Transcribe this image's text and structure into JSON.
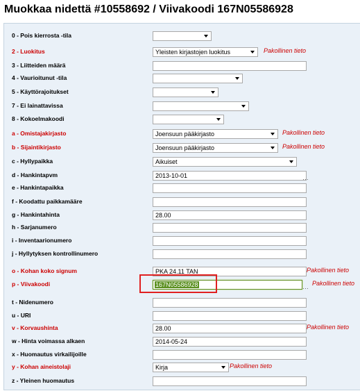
{
  "page": {
    "title": "Muokkaa nidettä #10558692 / Viivakoodi 167N05586928"
  },
  "required_text": "Pakollinen tieto",
  "fields": [
    {
      "label": "0 - Pois kierrosta -tila",
      "required": false,
      "type": "select",
      "value": ""
    },
    {
      "label": "2 - Luokitus",
      "required": true,
      "type": "select",
      "value": "Yleisten kirjastojen luokitus"
    },
    {
      "label": "3 - Liitteiden määrä",
      "required": false,
      "type": "text",
      "value": ""
    },
    {
      "label": "4 - Vaurioitunut -tila",
      "required": false,
      "type": "select",
      "value": ""
    },
    {
      "label": "5 - Käyttörajoitukset",
      "required": false,
      "type": "select",
      "value": ""
    },
    {
      "label": "7 - Ei lainattavissa",
      "required": false,
      "type": "select",
      "value": ""
    },
    {
      "label": "8 - Kokoelmakoodi",
      "required": false,
      "type": "select",
      "value": ""
    },
    {
      "label": "a - Omistajakirjasto",
      "required": true,
      "type": "select",
      "value": "Joensuun pääkirjasto"
    },
    {
      "label": "b - Sijaintikirjasto",
      "required": true,
      "type": "select",
      "value": "Joensuun pääkirjasto"
    },
    {
      "label": "c - Hyllypaikka",
      "required": false,
      "type": "select",
      "value": "Aikuiset"
    },
    {
      "label": "d - Hankintapvm",
      "required": false,
      "type": "text",
      "value": "2013-10-01"
    },
    {
      "label": "e - Hankintapaikka",
      "required": false,
      "type": "text",
      "value": ""
    },
    {
      "label": "f - Koodattu paikkamääre",
      "required": false,
      "type": "text",
      "value": ""
    },
    {
      "label": "g - Hankintahinta",
      "required": false,
      "type": "text",
      "value": "28.00"
    },
    {
      "label": "h - Sarjanumero",
      "required": false,
      "type": "text",
      "value": ""
    },
    {
      "label": "i - Inventaarionumero",
      "required": false,
      "type": "text",
      "value": ""
    },
    {
      "label": "j - Hyllytyksen kontrollinumero",
      "required": false,
      "type": "text",
      "value": ""
    },
    {
      "label": "o - Kohan koko signum",
      "required": true,
      "type": "text",
      "value": "PKA 24.11 TAN"
    },
    {
      "label": "p - Viivakoodi",
      "required": true,
      "type": "text",
      "value": "167N05586928",
      "focused": true
    },
    {
      "label": "t - Nidenumero",
      "required": false,
      "type": "text",
      "value": ""
    },
    {
      "label": "u - URI",
      "required": false,
      "type": "text",
      "value": ""
    },
    {
      "label": "v - Korvaushinta",
      "required": true,
      "type": "text",
      "value": "28.00"
    },
    {
      "label": "w - Hinta voimassa alkaen",
      "required": false,
      "type": "text",
      "value": "2014-05-24"
    },
    {
      "label": "x - Huomautus virkailijoille",
      "required": false,
      "type": "text",
      "value": ""
    },
    {
      "label": "y - Kohan aineistolaji",
      "required": true,
      "type": "select",
      "value": "Kirja"
    },
    {
      "label": "z - Yleinen huomautus",
      "required": false,
      "type": "text",
      "value": ""
    }
  ],
  "colors": {
    "required": "#cc0000",
    "panel_background": "#eaf1f8",
    "annotation": "#e02020",
    "focus_border": "#5f8c1e"
  }
}
